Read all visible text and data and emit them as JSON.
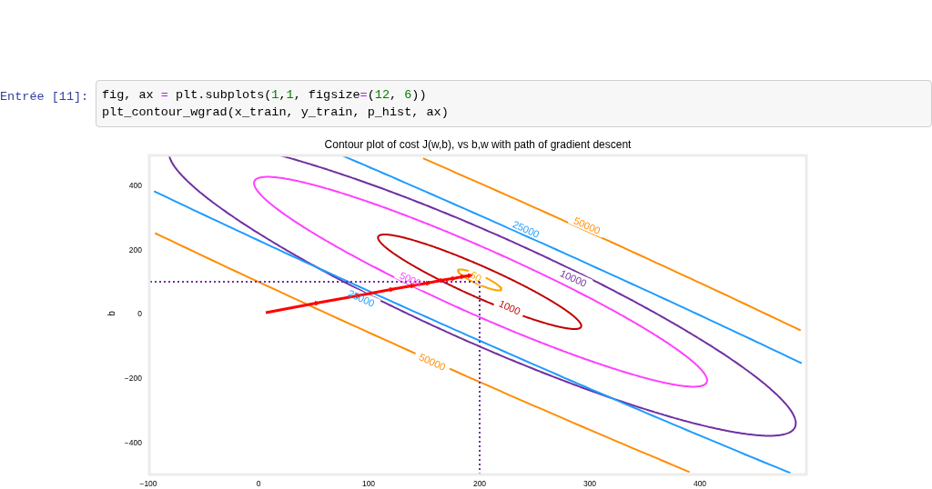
{
  "cell": {
    "prompt": "Entrée [11]:",
    "code_lines": [
      [
        {
          "kind": "text",
          "text": "fig, ax "
        },
        {
          "kind": "op",
          "text": "="
        },
        {
          "kind": "text",
          "text": " plt.subplots("
        },
        {
          "kind": "num",
          "text": "1"
        },
        {
          "kind": "text",
          "text": ","
        },
        {
          "kind": "num",
          "text": "1"
        },
        {
          "kind": "text",
          "text": ", figsize"
        },
        {
          "kind": "op",
          "text": "="
        },
        {
          "kind": "text",
          "text": "("
        },
        {
          "kind": "num",
          "text": "12"
        },
        {
          "kind": "text",
          "text": ", "
        },
        {
          "kind": "num",
          "text": "6"
        },
        {
          "kind": "text",
          "text": "))"
        }
      ],
      [
        {
          "kind": "text",
          "text": "plt_contour_wgrad(x_train, y_train, p_hist, ax)"
        }
      ]
    ]
  },
  "figure": {
    "title": "Contour plot of cost J(w,b), vs b,w with path of gradient descent",
    "ylabel": "b",
    "xticks": [
      "−100",
      "0",
      "100",
      "200",
      "300",
      "400"
    ],
    "yticks": [
      "400",
      "200",
      "0",
      "−200",
      "−400"
    ],
    "contours": [
      {
        "color": "#ffa500",
        "labels": [
          "50"
        ]
      },
      {
        "color": "#c00000",
        "labels": [
          "1000"
        ]
      },
      {
        "color": "#ff40ff",
        "labels": [
          "5000"
        ]
      },
      {
        "color": "#7030a0",
        "labels": [
          "10000"
        ]
      },
      {
        "color": "#1e9bff",
        "labels": [
          "25000",
          "25000"
        ]
      },
      {
        "color": "#ff8c00",
        "labels": [
          "50000",
          "50000"
        ]
      }
    ]
  }
}
